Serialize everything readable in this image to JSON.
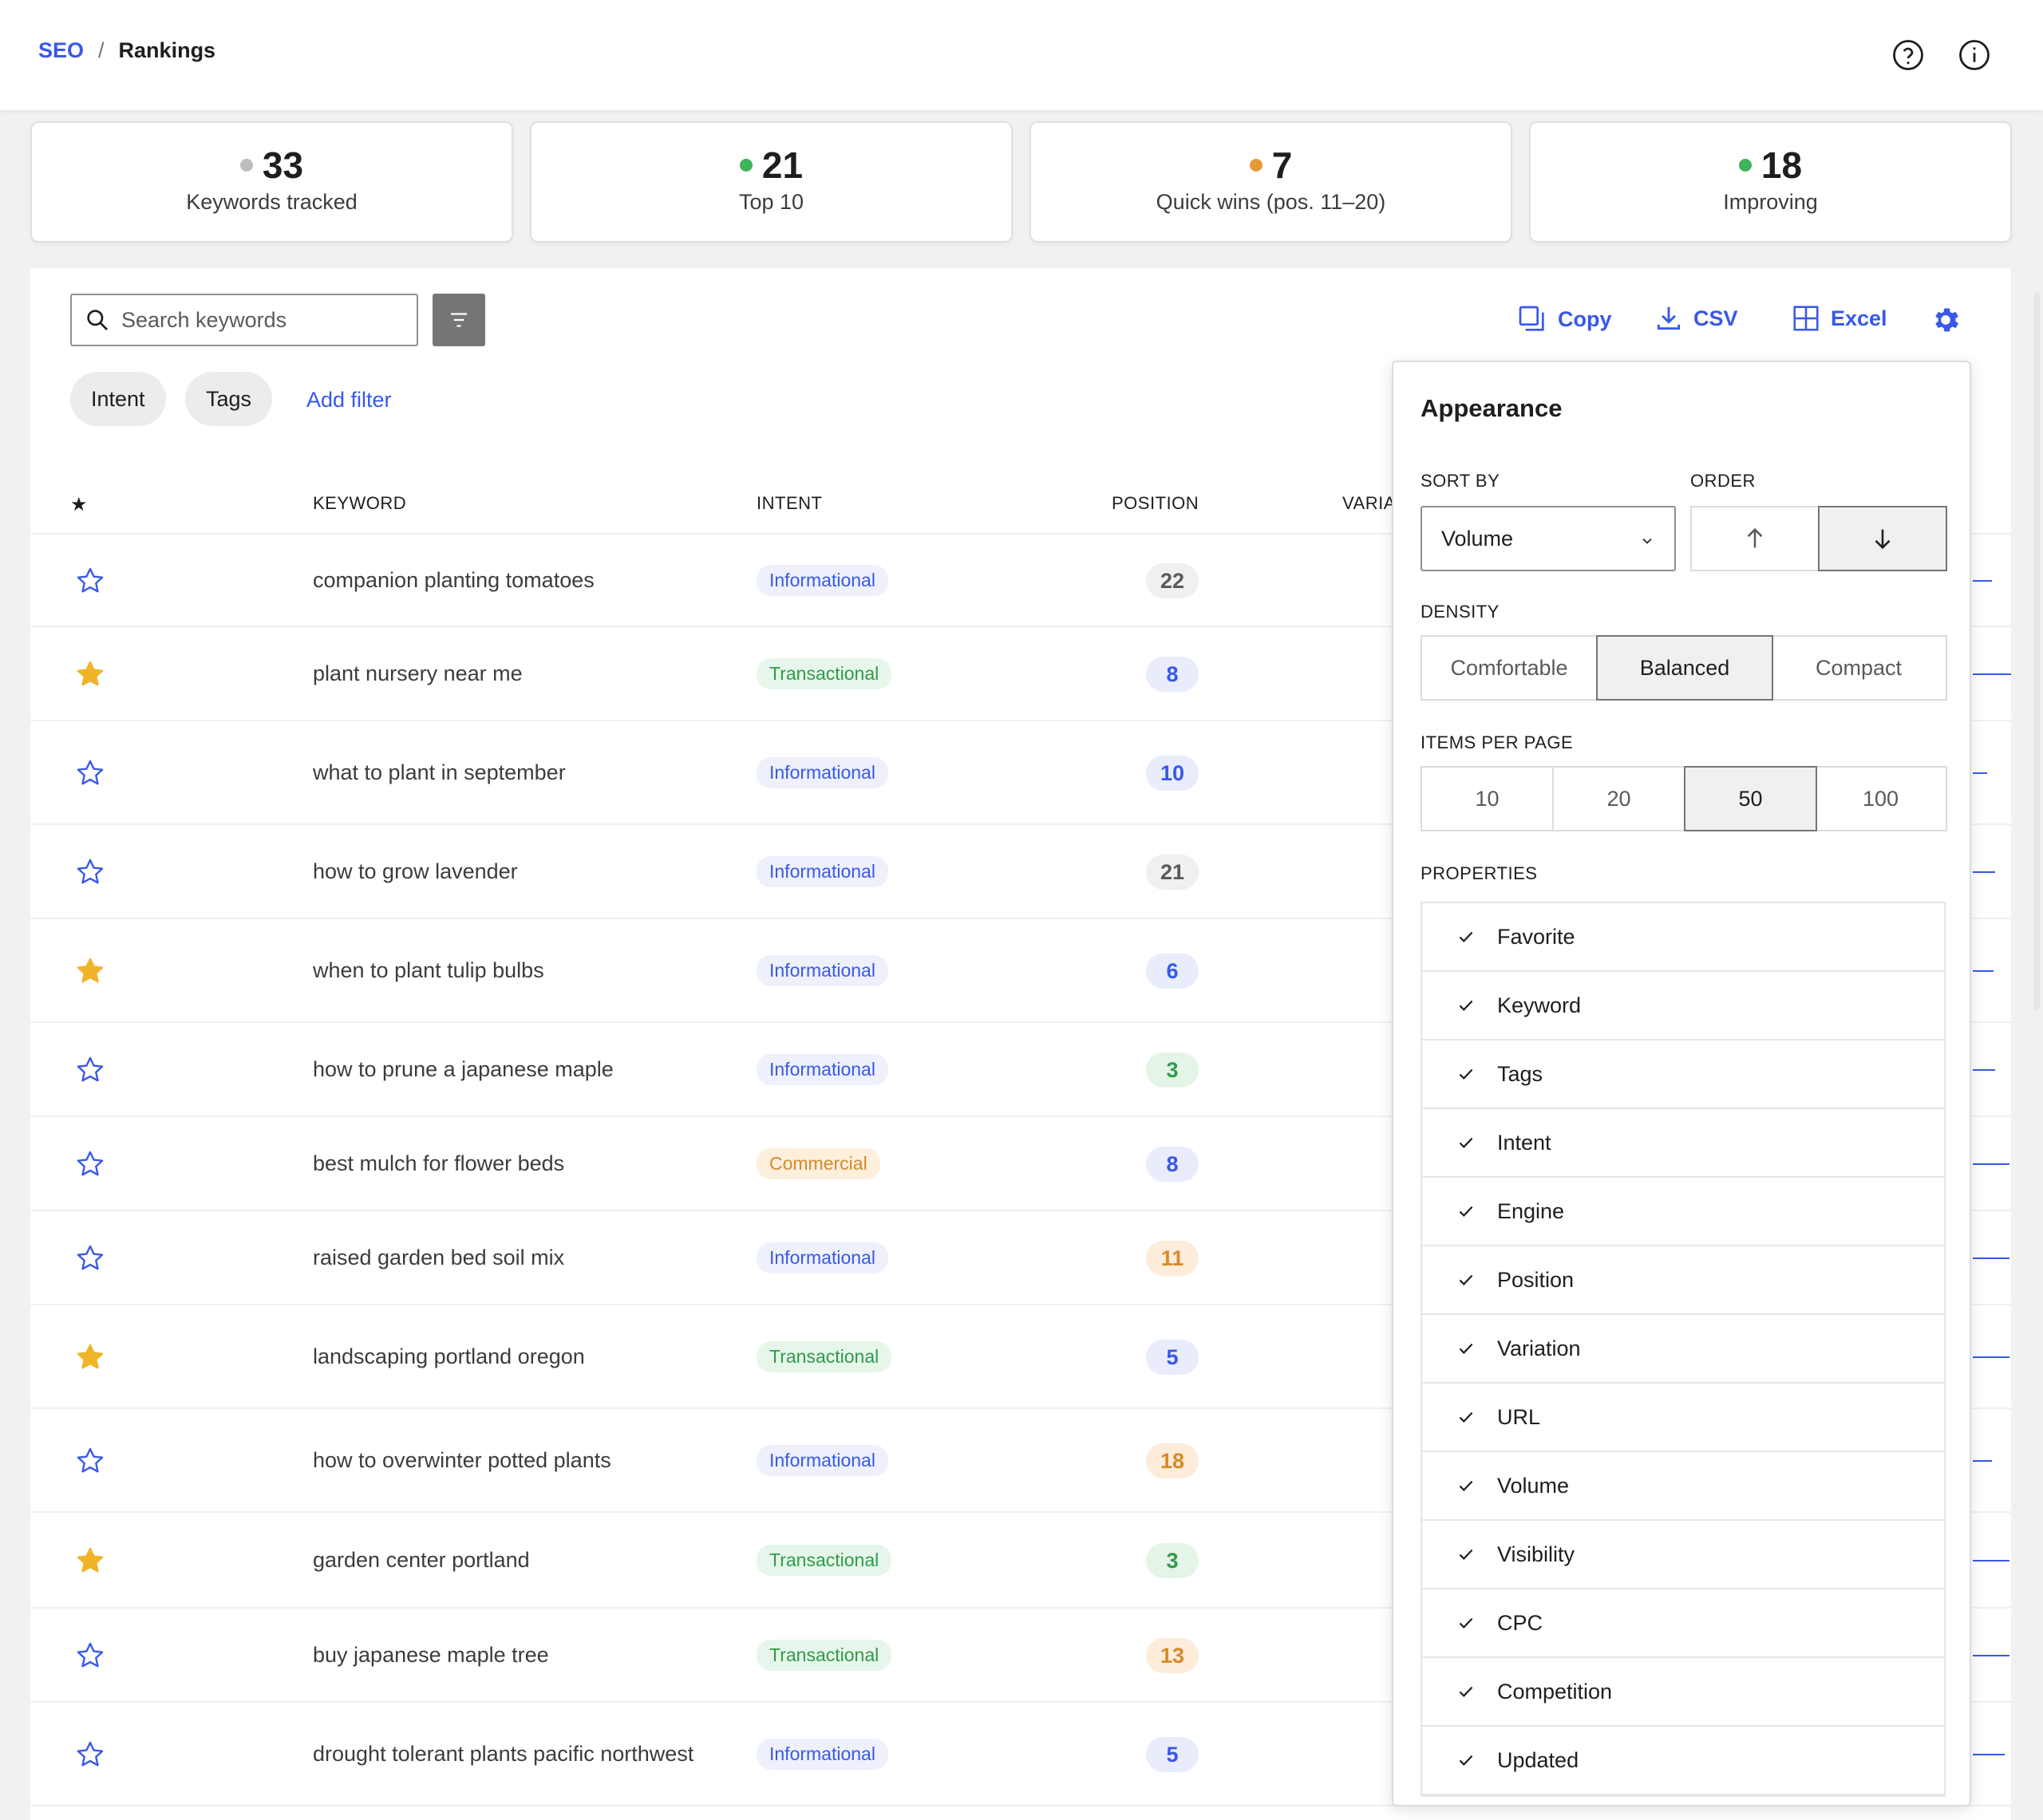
{
  "breadcrumb": {
    "root": "SEO",
    "separator": "/",
    "current": "Rankings"
  },
  "stats": [
    {
      "value": "33",
      "label": "Keywords tracked",
      "dot_color": "#bdbdbd"
    },
    {
      "value": "21",
      "label": "Top 10",
      "dot_color": "#3db35b"
    },
    {
      "value": "7",
      "label": "Quick wins (pos. 11–20)",
      "dot_color": "#e59a3a"
    },
    {
      "value": "18",
      "label": "Improving",
      "dot_color": "#3db35b"
    }
  ],
  "toolbar": {
    "search_placeholder": "Search keywords",
    "chips": [
      "Intent",
      "Tags"
    ],
    "add_filter": "Add filter",
    "copy": "Copy",
    "csv": "CSV",
    "excel": "Excel"
  },
  "table": {
    "headers": {
      "favorite": "★",
      "keyword": "KEYWORD",
      "intent": "INTENT",
      "position": "POSITION",
      "variation": "VARIA"
    },
    "rows": [
      {
        "favorite": false,
        "keyword": "companion planting tomatoes",
        "intent": "Informational",
        "position": "22",
        "pos_style": "grey"
      },
      {
        "favorite": true,
        "keyword": "plant nursery near me",
        "intent": "Transactional",
        "position": "8",
        "pos_style": "blue"
      },
      {
        "favorite": false,
        "keyword": "what to plant in september",
        "intent": "Informational",
        "position": "10",
        "pos_style": "blue"
      },
      {
        "favorite": false,
        "keyword": "how to grow lavender",
        "intent": "Informational",
        "position": "21",
        "pos_style": "grey"
      },
      {
        "favorite": true,
        "keyword": "when to plant tulip bulbs",
        "intent": "Informational",
        "position": "6",
        "pos_style": "blue"
      },
      {
        "favorite": false,
        "keyword": "how to prune a japanese maple",
        "intent": "Informational",
        "position": "3",
        "pos_style": "green"
      },
      {
        "favorite": false,
        "keyword": "best mulch for flower beds",
        "intent": "Commercial",
        "position": "8",
        "pos_style": "blue"
      },
      {
        "favorite": false,
        "keyword": "raised garden bed soil mix",
        "intent": "Informational",
        "position": "11",
        "pos_style": "orange"
      },
      {
        "favorite": true,
        "keyword": "landscaping portland oregon",
        "intent": "Transactional",
        "position": "5",
        "pos_style": "blue"
      },
      {
        "favorite": false,
        "keyword": "how to overwinter potted plants",
        "intent": "Informational",
        "position": "18",
        "pos_style": "orange"
      },
      {
        "favorite": true,
        "keyword": "garden center portland",
        "intent": "Transactional",
        "position": "3",
        "pos_style": "green"
      },
      {
        "favorite": false,
        "keyword": "buy japanese maple tree",
        "intent": "Transactional",
        "position": "13",
        "pos_style": "orange"
      },
      {
        "favorite": false,
        "keyword": "drought tolerant plants pacific northwest",
        "intent": "Informational",
        "position": "5",
        "pos_style": "blue"
      }
    ]
  },
  "appearance": {
    "title": "Appearance",
    "sort_by_label": "SORT BY",
    "sort_by_value": "Volume",
    "order_label": "ORDER",
    "order_selected": "descending",
    "density_label": "DENSITY",
    "density_options": [
      "Comfortable",
      "Balanced",
      "Compact"
    ],
    "density_selected": "Balanced",
    "items_label": "ITEMS PER PAGE",
    "items_options": [
      "10",
      "20",
      "50",
      "100"
    ],
    "items_selected": "50",
    "properties_label": "PROPERTIES",
    "properties": [
      "Favorite",
      "Keyword",
      "Tags",
      "Intent",
      "Engine",
      "Position",
      "Variation",
      "URL",
      "Volume",
      "Visibility",
      "CPC",
      "Competition",
      "Updated"
    ]
  },
  "colors": {
    "accent": "#3858e9",
    "star_filled": "#f0b429"
  }
}
